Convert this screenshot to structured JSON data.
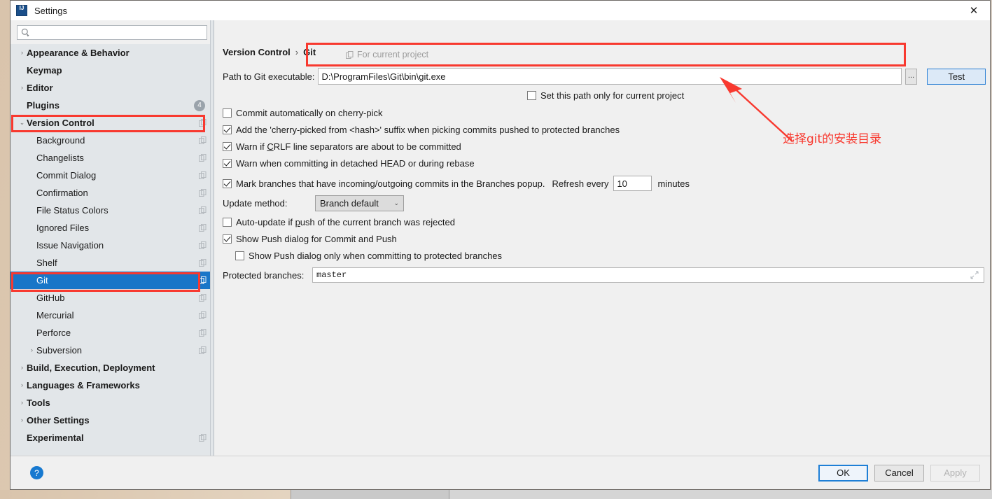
{
  "window": {
    "title": "Settings",
    "app_icon": "intellij-idea-icon",
    "close_icon": "close-icon"
  },
  "sidebar": {
    "search": {
      "placeholder": "",
      "value": "",
      "icon": "search-icon"
    },
    "items": [
      {
        "label": "Appearance & Behavior",
        "level": 0,
        "bold": true,
        "arrow": "›",
        "copy": false,
        "badge": null,
        "selected": false
      },
      {
        "label": "Keymap",
        "level": 0,
        "bold": true,
        "arrow": "",
        "copy": false,
        "badge": null,
        "selected": false
      },
      {
        "label": "Editor",
        "level": 0,
        "bold": true,
        "arrow": "›",
        "copy": false,
        "badge": null,
        "selected": false
      },
      {
        "label": "Plugins",
        "level": 0,
        "bold": true,
        "arrow": "",
        "copy": false,
        "badge": "4",
        "selected": false
      },
      {
        "label": "Version Control",
        "level": 0,
        "bold": true,
        "arrow": "⌄",
        "copy": true,
        "badge": null,
        "selected": false
      },
      {
        "label": "Background",
        "level": 1,
        "bold": false,
        "arrow": "",
        "copy": true,
        "badge": null,
        "selected": false
      },
      {
        "label": "Changelists",
        "level": 1,
        "bold": false,
        "arrow": "",
        "copy": true,
        "badge": null,
        "selected": false
      },
      {
        "label": "Commit Dialog",
        "level": 1,
        "bold": false,
        "arrow": "",
        "copy": true,
        "badge": null,
        "selected": false
      },
      {
        "label": "Confirmation",
        "level": 1,
        "bold": false,
        "arrow": "",
        "copy": true,
        "badge": null,
        "selected": false
      },
      {
        "label": "File Status Colors",
        "level": 1,
        "bold": false,
        "arrow": "",
        "copy": true,
        "badge": null,
        "selected": false
      },
      {
        "label": "Ignored Files",
        "level": 1,
        "bold": false,
        "arrow": "",
        "copy": true,
        "badge": null,
        "selected": false
      },
      {
        "label": "Issue Navigation",
        "level": 1,
        "bold": false,
        "arrow": "",
        "copy": true,
        "badge": null,
        "selected": false
      },
      {
        "label": "Shelf",
        "level": 1,
        "bold": false,
        "arrow": "",
        "copy": true,
        "badge": null,
        "selected": false
      },
      {
        "label": "Git",
        "level": 1,
        "bold": false,
        "arrow": "",
        "copy": true,
        "badge": null,
        "selected": true
      },
      {
        "label": "GitHub",
        "level": 1,
        "bold": false,
        "arrow": "",
        "copy": true,
        "badge": null,
        "selected": false
      },
      {
        "label": "Mercurial",
        "level": 1,
        "bold": false,
        "arrow": "",
        "copy": true,
        "badge": null,
        "selected": false
      },
      {
        "label": "Perforce",
        "level": 1,
        "bold": false,
        "arrow": "",
        "copy": true,
        "badge": null,
        "selected": false
      },
      {
        "label": "Subversion",
        "level": 1,
        "bold": false,
        "arrow": "›",
        "copy": true,
        "badge": null,
        "selected": false
      },
      {
        "label": "Build, Execution, Deployment",
        "level": 0,
        "bold": true,
        "arrow": "›",
        "copy": false,
        "badge": null,
        "selected": false
      },
      {
        "label": "Languages & Frameworks",
        "level": 0,
        "bold": true,
        "arrow": "›",
        "copy": false,
        "badge": null,
        "selected": false
      },
      {
        "label": "Tools",
        "level": 0,
        "bold": true,
        "arrow": "›",
        "copy": false,
        "badge": null,
        "selected": false
      },
      {
        "label": "Other Settings",
        "level": 0,
        "bold": true,
        "arrow": "›",
        "copy": false,
        "badge": null,
        "selected": false
      },
      {
        "label": "Experimental",
        "level": 0,
        "bold": true,
        "arrow": "",
        "copy": true,
        "badge": null,
        "selected": false
      }
    ]
  },
  "main": {
    "breadcrumb_parent": "Version Control",
    "breadcrumb_sep": "›",
    "breadcrumb_current": "Git",
    "for_current_project": "For current project",
    "path_label": "Path to Git executable:",
    "path_value": "D:\\ProgramFiles\\Git\\bin\\git.exe",
    "browse_label": "...",
    "test_label": "Test",
    "set_path_only_label": "Set this path only for current project",
    "set_path_only_checked": false,
    "checkboxes": [
      {
        "label": "Commit automatically on cherry-pick",
        "checked": false
      },
      {
        "label": "Add the 'cherry-picked from <hash>' suffix when picking commits pushed to protected branches",
        "checked": true
      },
      {
        "label": "Warn if CRLF line separators are about to be committed",
        "checked": true
      },
      {
        "label": "Warn when committing in detached HEAD or during rebase",
        "checked": true
      }
    ],
    "mark_branches_label": "Mark branches that have incoming/outgoing commits in the Branches popup.",
    "mark_branches_checked": true,
    "refresh_every_label": "Refresh every",
    "refresh_value": "10",
    "minutes_label": "minutes",
    "update_method_label": "Update method:",
    "update_method_value": "Branch default",
    "update_method_caret": "⌄",
    "auto_update_label": "Auto-update if push of the current branch was rejected",
    "auto_update_checked": false,
    "show_push_label": "Show Push dialog for Commit and Push",
    "show_push_checked": true,
    "show_push_protected_label": "Show Push dialog only when committing to protected branches",
    "show_push_protected_checked": false,
    "protected_branches_label": "Protected branches:",
    "protected_branches_value": "master",
    "expand_icon": "expand-icon"
  },
  "footer": {
    "help_label": "?",
    "ok_label": "OK",
    "cancel_label": "Cancel",
    "apply_label": "Apply"
  },
  "annotations": {
    "note_text": "选择git的安装目录",
    "color": "#f8392f"
  }
}
